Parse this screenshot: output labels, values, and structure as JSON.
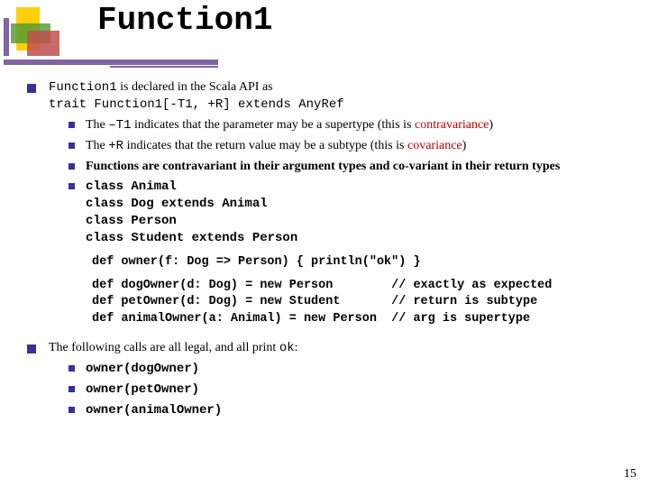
{
  "title": "Function1",
  "point1": {
    "pre": " is declared in the Scala API as",
    "code_name": "Function1",
    "code_line": "trait Function1[-T1, +R] extends AnyRef"
  },
  "sub": {
    "a": {
      "t1": "The ",
      "code": "–T1",
      "t2": " indicates that the parameter may be a supertype (this is ",
      "red": "contravariance",
      "t3": ")"
    },
    "b": {
      "t1": "The ",
      "code": "+R",
      "t2": " indicates that the return value may be a subtype (this is ",
      "red": "covariance",
      "t3": ")"
    },
    "c": "Functions are contravariant in their argument types and co-variant in their return types"
  },
  "classes": "class Animal\nclass Dog extends Animal\nclass Person\nclass Student extends Person",
  "owner_def": "def owner(f: Dog => Person) { println(\"ok\") }",
  "defs": "def dogOwner(d: Dog) = new Person        // exactly as expected\ndef petOwner(d: Dog) = new Student       // return is subtype\ndef animalOwner(a: Animal) = new Person  // arg is supertype",
  "point2": {
    "t1": "The following calls are all legal, and all print ",
    "code": "ok",
    "t2": ":"
  },
  "calls": {
    "a": "owner(dogOwner)",
    "b": "owner(petOwner)",
    "c": "owner(animalOwner)"
  },
  "pagenum": "15"
}
